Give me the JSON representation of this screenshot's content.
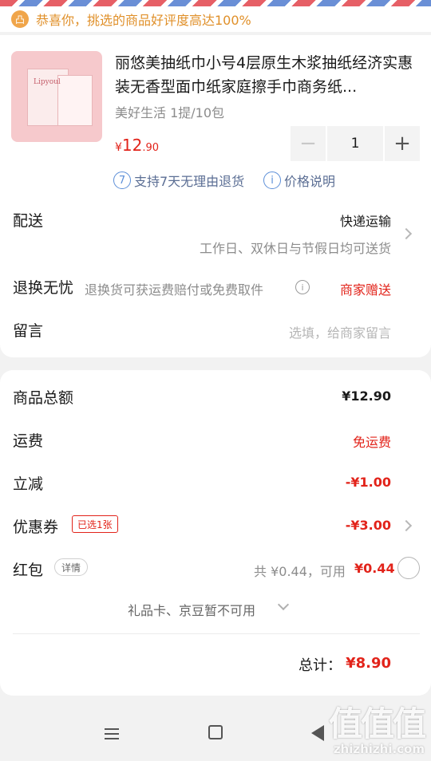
{
  "notice": {
    "icon": "shop-bag-icon",
    "text": "恭喜你，挑选的商品好评度高达100%"
  },
  "product": {
    "logo_text": "Lipyoul",
    "title": "丽悠美抽纸巾小号4层原生木浆抽纸经济实惠装无香型面巾纸家庭擦手巾商务纸...",
    "spec": "美好生活 1提/10包",
    "price": {
      "currency": "¥",
      "integer": "12",
      "decimal": ".90"
    },
    "quantity": "1",
    "services": [
      {
        "icon_char": "7",
        "text": "支持7天无理由退货"
      },
      {
        "icon_char": "i",
        "text": "价格说明"
      }
    ]
  },
  "delivery": {
    "label": "配送",
    "method": "快递运输",
    "note": "工作日、双休日与节假日均可送货"
  },
  "returns": {
    "label": "退换无忧",
    "desc": "退换货可获运费赔付或免费取件",
    "tag": "商家赠送"
  },
  "message": {
    "label": "留言",
    "placeholder": "选填，给商家留言"
  },
  "summary": {
    "subtotal_label": "商品总额",
    "subtotal": "¥12.90",
    "shipping_label": "运费",
    "shipping": "免运费",
    "discount_label": "立减",
    "discount": "-¥1.00",
    "coupon_label": "优惠券",
    "coupon_badge": "已选1张",
    "coupon": "-¥3.00",
    "redpacket_label": "红包",
    "redpacket_detail": "详情",
    "redpacket_total": "共 ¥0.44，可用",
    "redpacket_avail": "¥0.44",
    "giftcard_note": "礼品卡、京豆暂不可用",
    "total_label": "总计：",
    "total": "¥8.90"
  },
  "watermark": {
    "glyphs": "值值值",
    "url": "zhizhizhi.com"
  },
  "colors": {
    "accent": "#e2231a",
    "notice": "#e0902a",
    "link": "#5b8ed8"
  }
}
